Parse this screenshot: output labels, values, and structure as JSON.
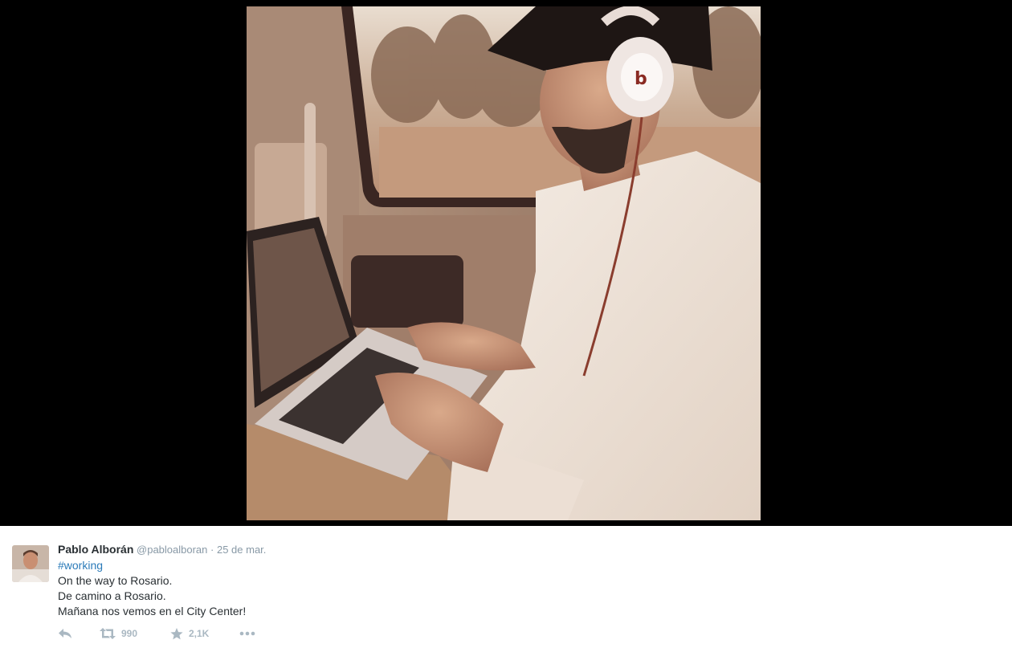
{
  "tweet": {
    "fullname": "Pablo Alborán",
    "username": "@pabloalboran",
    "separator": "·",
    "timestamp": "25 de mar.",
    "hashtag": "#working",
    "lines": [
      "On the way to Rosario.",
      "De camino a Rosario.",
      "Mañana nos vemos en el City Center!"
    ]
  },
  "actions": {
    "reply_icon": "reply-icon",
    "retweet_icon": "retweet-icon",
    "retweet_count": "990",
    "favorite_icon": "star-icon",
    "favorite_count": "2,1K",
    "more_icon": "more-dots-icon"
  },
  "colors": {
    "background_media": "#000000",
    "panel": "#ffffff",
    "name": "#292f33",
    "meta": "#8899a6",
    "link": "#2b7bb9",
    "action": "#aab8c2"
  }
}
